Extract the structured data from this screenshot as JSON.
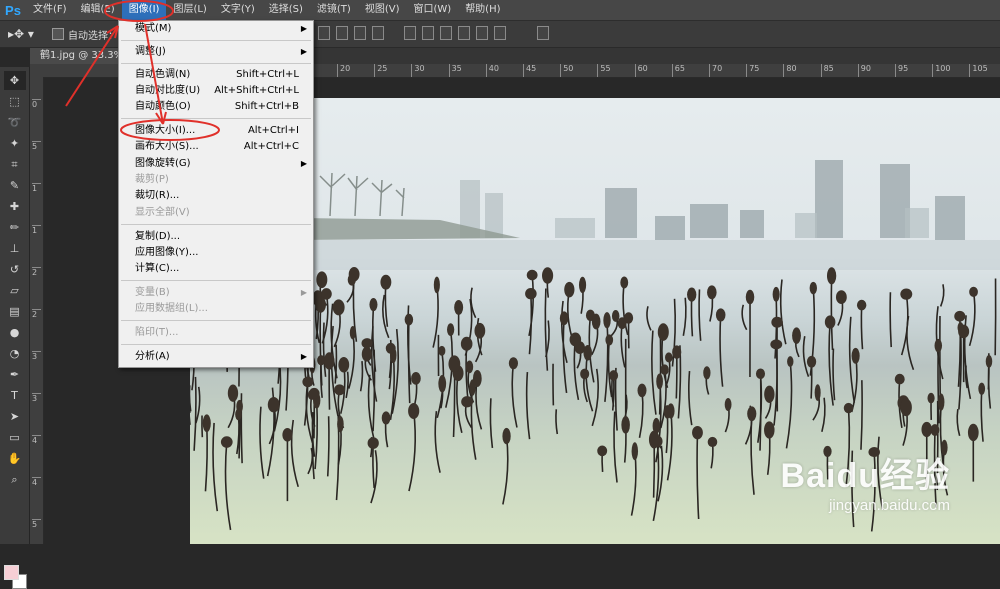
{
  "app": {
    "logo": "Ps"
  },
  "menubar": {
    "items": [
      "文件(F)",
      "编辑(E)",
      "图像(I)",
      "图层(L)",
      "文字(Y)",
      "选择(S)",
      "滤镜(T)",
      "视图(V)",
      "窗口(W)",
      "帮助(H)"
    ],
    "active_index": 2
  },
  "options": {
    "auto_select_label": "自动选择："
  },
  "document": {
    "tab_title": "鹤1.jpg @ 33.3%(R"
  },
  "ruler": {
    "h_labels": [
      "20",
      "25",
      "30",
      "35",
      "40",
      "45",
      "50",
      "55",
      "60",
      "65",
      "70",
      "75",
      "80",
      "85",
      "90",
      "95",
      "100",
      "105"
    ],
    "v_labels": [
      "0",
      "5",
      "1",
      "1",
      "2",
      "2",
      "3",
      "3",
      "4",
      "4",
      "5"
    ]
  },
  "image_menu": {
    "items": [
      {
        "label": "模式(M)",
        "shortcut": "",
        "submenu": true,
        "disabled": false
      },
      {
        "label": "调整(J)",
        "shortcut": "",
        "submenu": true,
        "disabled": false
      },
      {
        "label": "自动色调(N)",
        "shortcut": "Shift+Ctrl+L",
        "submenu": false,
        "disabled": false
      },
      {
        "label": "自动对比度(U)",
        "shortcut": "Alt+Shift+Ctrl+L",
        "submenu": false,
        "disabled": false
      },
      {
        "label": "自动颜色(O)",
        "shortcut": "Shift+Ctrl+B",
        "submenu": false,
        "disabled": false
      },
      {
        "label": "图像大小(I)...",
        "shortcut": "Alt+Ctrl+I",
        "submenu": false,
        "disabled": false
      },
      {
        "label": "画布大小(S)...",
        "shortcut": "Alt+Ctrl+C",
        "submenu": false,
        "disabled": false
      },
      {
        "label": "图像旋转(G)",
        "shortcut": "",
        "submenu": true,
        "disabled": false
      },
      {
        "label": "裁剪(P)",
        "shortcut": "",
        "submenu": false,
        "disabled": true
      },
      {
        "label": "裁切(R)...",
        "shortcut": "",
        "submenu": false,
        "disabled": false
      },
      {
        "label": "显示全部(V)",
        "shortcut": "",
        "submenu": false,
        "disabled": true
      },
      {
        "label": "复制(D)...",
        "shortcut": "",
        "submenu": false,
        "disabled": false
      },
      {
        "label": "应用图像(Y)...",
        "shortcut": "",
        "submenu": false,
        "disabled": false
      },
      {
        "label": "计算(C)...",
        "shortcut": "",
        "submenu": false,
        "disabled": false
      },
      {
        "label": "变量(B)",
        "shortcut": "",
        "submenu": true,
        "disabled": true
      },
      {
        "label": "应用数据组(L)...",
        "shortcut": "",
        "submenu": false,
        "disabled": true
      },
      {
        "label": "陷印(T)...",
        "shortcut": "",
        "submenu": false,
        "disabled": true
      },
      {
        "label": "分析(A)",
        "shortcut": "",
        "submenu": true,
        "disabled": false
      }
    ]
  },
  "watermark": {
    "brand": "Baidu经验",
    "url": "jingyan.baidu.com"
  },
  "colors": {
    "accent": "#2d6fba",
    "annotation": "#e0302a",
    "foreground_swatch": "#f6cfd5",
    "background_swatch": "#ffffff"
  }
}
